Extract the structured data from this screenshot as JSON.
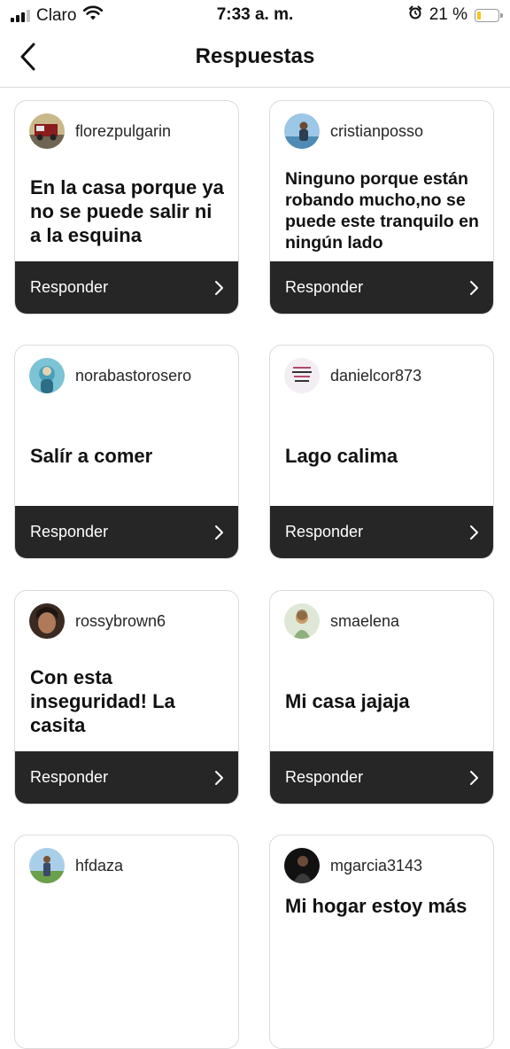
{
  "status": {
    "carrier": "Claro",
    "time": "7:33 a. m.",
    "battery": "21 %",
    "battery_level": 0.21,
    "battery_color": "#f5c518",
    "icons": [
      "signal-icon",
      "wifi-icon",
      "alarm-icon",
      "battery-icon"
    ]
  },
  "nav": {
    "title": "Respuestas",
    "back_icon": "chevron-left-icon"
  },
  "reply_label": "Responder",
  "cards": [
    {
      "user": "florezpulgarin",
      "answer": "En la casa porque ya no se puede salir ni a la esquina"
    },
    {
      "user": "cristianposso",
      "answer": "Ninguno porque están robando mucho,no se puede este tranquilo en ningún lado"
    },
    {
      "user": "norabastorosero",
      "answer": "Salír a comer"
    },
    {
      "user": "danielcor873",
      "answer": "Lago calima"
    },
    {
      "user": "rossybrown6",
      "answer": "Con esta inseguridad! La casita"
    },
    {
      "user": "smaelena",
      "answer": "Mi casa jajaja"
    },
    {
      "user": "hfdaza",
      "answer": ""
    },
    {
      "user": "mgarcia3143",
      "answer": "Mi hogar estoy más"
    }
  ]
}
